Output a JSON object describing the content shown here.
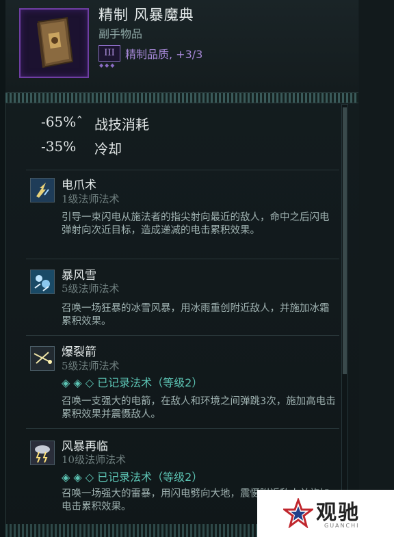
{
  "item": {
    "title": "精制 风暴魔典",
    "type": "副手物品",
    "quality_badge": "III",
    "quality_dots": "◆◆◆",
    "quality_text": "精制品质, +3/3"
  },
  "stats": [
    {
      "value": "-65%ˆ",
      "label": "战技消耗"
    },
    {
      "value": "-35%",
      "label": "冷却"
    }
  ],
  "spells": [
    {
      "name": "电爪术",
      "level": "1级法师法术",
      "description": "引导一束闪电从施法者的指尖射向最近的敌人，命中之后闪电弹射向次近目标，造成递减的电击累积效果。",
      "icon": "lightning-claw-icon"
    },
    {
      "name": "暴风雪",
      "level": "5级法师法术",
      "description": "召唤一场狂暴的冰雪风暴，用冰雨重创附近敌人，并施加冰霜累积效果。",
      "icon": "blizzard-icon"
    },
    {
      "name": "爆裂箭",
      "level": "5级法师法术",
      "recorded": "◈ ◈ ◇  已记录法术（等级2）",
      "description": "召唤一支强大的电箭，在敌人和环境之间弹跳3次，施加高电击累积效果并震慑敌人。",
      "icon": "burst-arrow-icon"
    },
    {
      "name": "风暴再临",
      "level": "10级法师法术",
      "recorded": "◈ ◈ ◇  已记录法术（等级2）",
      "description": "召唤一场强大的雷暴，用闪电劈向大地，震慑附近敌人并施加电击累积效果。",
      "icon": "storm-cloud-icon"
    }
  ],
  "watermark": {
    "text": "观驰",
    "sub": "GUANCHI"
  },
  "colors": {
    "quality": "#a789d8",
    "recorded": "#5cc4b4"
  }
}
